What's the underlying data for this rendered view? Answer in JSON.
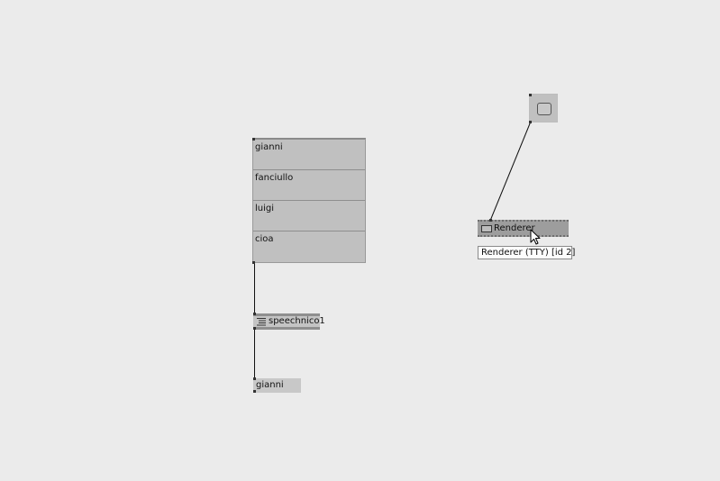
{
  "menu": {
    "items": [
      {
        "label": "gianni"
      },
      {
        "label": "fanciullo"
      },
      {
        "label": "luigi"
      },
      {
        "label": "cioa"
      }
    ]
  },
  "speech": {
    "label": "speechnico1",
    "icon": "list-icon"
  },
  "output": {
    "value": "gianni"
  },
  "toggle": {
    "icon": "rounded-square-icon"
  },
  "renderer": {
    "label": "Renderer",
    "icon": "monitor-icon",
    "tooltip": "Renderer (TTY) [id 2]"
  },
  "cursor": {
    "icon": "arrow-pointer-icon"
  }
}
